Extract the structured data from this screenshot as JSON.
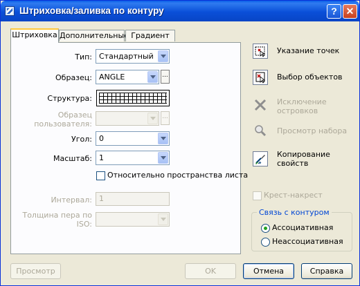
{
  "window": {
    "title": "Штриховка/заливка по контуру",
    "help_label": "?",
    "close_label": "✕"
  },
  "tabs": [
    "Штриховка",
    "Дополнительные",
    "Градиент"
  ],
  "hatch": {
    "type_label": "Тип:",
    "type_value": "Стандартный",
    "pattern_label": "Образец:",
    "pattern_value": "ANGLE",
    "swatch_label": "Структура:",
    "custom_label_1": "Образец",
    "custom_label_2": "пользователя:",
    "angle_label": "Угол:",
    "angle_value": "0",
    "scale_label": "Масштаб:",
    "scale_value": "1",
    "relative_label": "Относительно пространства листа",
    "spacing_label": "Интервал:",
    "spacing_value": "1",
    "pen_label_1": "Толщина пера по",
    "pen_label_2": "ISO:",
    "ellipsis": "..."
  },
  "actions": {
    "pick_points": "Указание точек",
    "select_objects": "Выбор объектов",
    "remove_islands_1": "Исключение",
    "remove_islands_2": "островков",
    "view_selection": "Просмотр набора",
    "inherit_1": "Копирование",
    "inherit_2": "свойств"
  },
  "options": {
    "double_label": "Крест-накрест",
    "composition_title": "Связь с контуром",
    "associative": "Ассоциативная",
    "nonassociative": "Неассоциативная"
  },
  "buttons": {
    "preview": "Просмотр",
    "ok": "OK",
    "cancel": "Отмена",
    "help": "Справка"
  }
}
